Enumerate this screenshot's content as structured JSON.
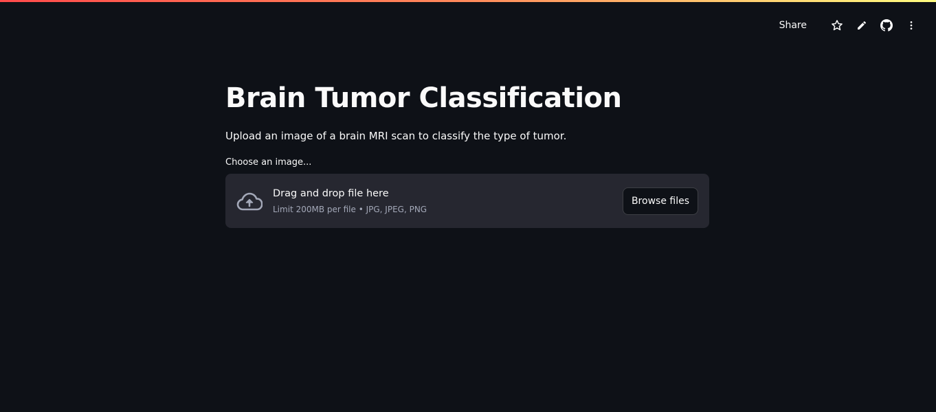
{
  "toolbar": {
    "share_label": "Share",
    "icons": [
      "star-icon",
      "pencil-icon",
      "github-icon",
      "more-vertical-icon"
    ]
  },
  "main": {
    "title": "Brain Tumor Classification",
    "subtitle": "Upload an image of a brain MRI scan to classify the type of tumor."
  },
  "uploader": {
    "label": "Choose an image...",
    "drop_text": "Drag and drop file here",
    "limit_text": "Limit 200MB per file • JPG, JPEG, PNG",
    "browse_label": "Browse files",
    "icon": "cloud-upload-icon"
  },
  "colors": {
    "background": "#0e1117",
    "dropzone": "#262730",
    "text": "#fafafa",
    "muted_text": "#a3a8b8",
    "accent_gradient_start": "#ff4b4b",
    "accent_gradient_end": "#fffd80"
  }
}
